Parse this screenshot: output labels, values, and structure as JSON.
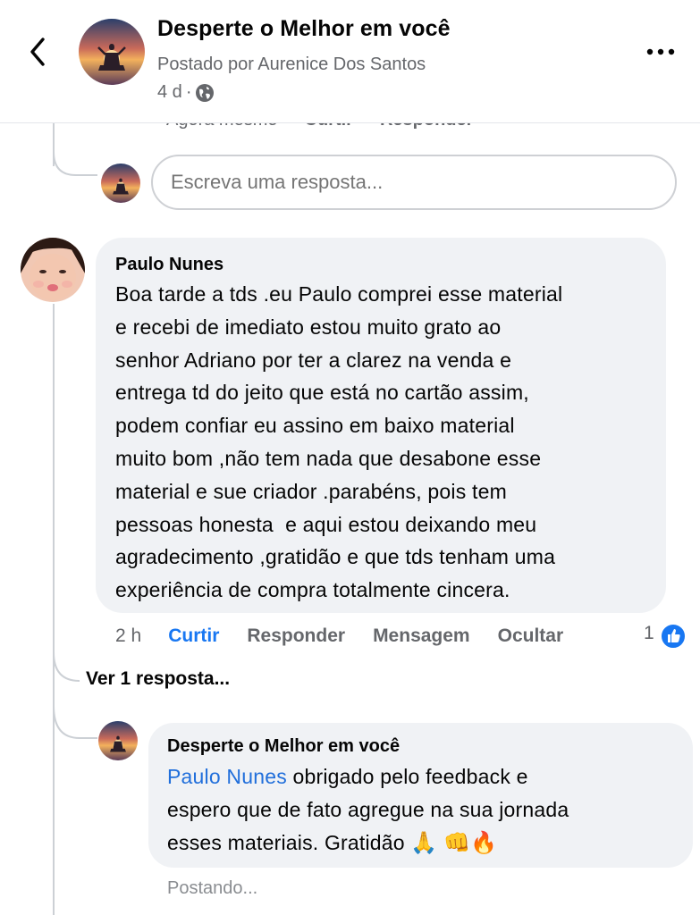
{
  "header": {
    "page_title": "Desperte o Melhor em você",
    "posted_by": "Postado por Aurenice Dos Santos",
    "time": "4 d",
    "separator": "·",
    "back_icon": "chevron-left-icon",
    "more_icon": "more-horizontal-icon",
    "audience_icon": "globe-icon"
  },
  "previous_actions": {
    "time": "Agora mesmo",
    "like": "Curtir",
    "reply": "Responder"
  },
  "reply_box": {
    "placeholder": "Escreva uma resposta..."
  },
  "comment": {
    "author": "Paulo Nunes",
    "text": "Boa tarde a tds .eu Paulo comprei esse material\ne recebi de imediato estou muito grato ao\nsenhor Adriano por ter a clarez na venda e\nentrega td do jeito que está no cartão assim,\npodem confiar eu assino em baixo material\nmuito bom ,não tem nada que desabone esse\nmaterial e sue criador .parabéns, pois tem\npessoas honesta  e aqui estou deixando meu\nagradecimento ,gratidão e que tds tenham uma\nexperiência de compra totalmente cincera.",
    "actions": {
      "time": "2 h",
      "like": "Curtir",
      "reply": "Responder",
      "message": "Mensagem",
      "hide": "Ocultar"
    },
    "reaction_count": "1",
    "reaction_icon": "thumbs-up-icon",
    "view_replies": "Ver 1 resposta..."
  },
  "reply": {
    "author": "Desperte o Melhor em você",
    "mention": "Paulo Nunes",
    "text_line1": " obrigado pelo feedback e",
    "text_line2": "espero que de fato agregue na sua jornada",
    "text_line3": "esses materiais. Gratidão ",
    "emojis": "🙏 👊🔥",
    "status": "Postando..."
  },
  "colors": {
    "accent": "#1877f2",
    "mention": "#216fdb",
    "muted_text": "#65676b",
    "bubble_bg": "#f0f2f5",
    "thread_line": "#ccd0d5"
  }
}
